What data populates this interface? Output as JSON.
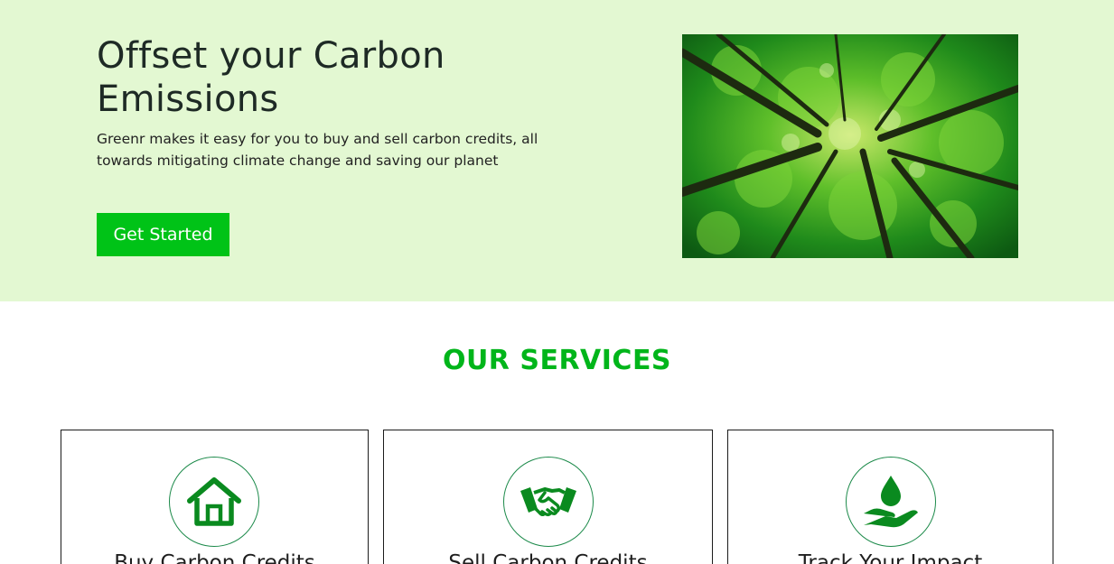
{
  "hero": {
    "title": "Offset your Carbon Emissions",
    "description": "Greenr makes it easy for you to buy and sell carbon credits, all towards mitigating climate change and saving our planet",
    "cta_label": "Get Started",
    "image_subject": "forest-canopy-photo"
  },
  "services": {
    "heading": "OUR SERVICES",
    "items": [
      {
        "title": "Buy Carbon Credits",
        "icon": "home-icon"
      },
      {
        "title": "Sell Carbon Credits",
        "icon": "handshake-icon"
      },
      {
        "title": "Track Your Impact",
        "icon": "water-drop-hand-icon"
      }
    ]
  },
  "colors": {
    "accent_green": "#00c317",
    "heading_green": "#00b51a",
    "hero_background": "#e3f8d2",
    "icon_green": "#0a8a1f"
  }
}
